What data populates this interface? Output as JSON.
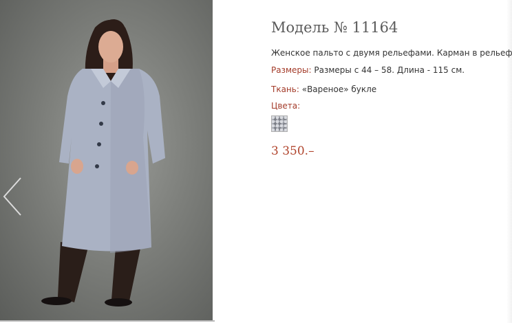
{
  "product": {
    "title": "Модель № 11164",
    "description": "Женское пальто с двумя рельефами. Карман в рельефе.",
    "sizes_label": "Размеры:",
    "sizes_value": "Размеры с 44 – 58. Длина - 115 см.",
    "fabric_label": "Ткань:",
    "fabric_value": "«Вареное» букле",
    "colors_label": "Цвета:",
    "price": "3 350.–"
  },
  "colors": {
    "label_accent": "#a33a28",
    "price": "#b0442c",
    "coat": "#aab2c4",
    "swatch": "#a9acb4"
  },
  "icons": {
    "prev": "chevron-left-icon"
  }
}
